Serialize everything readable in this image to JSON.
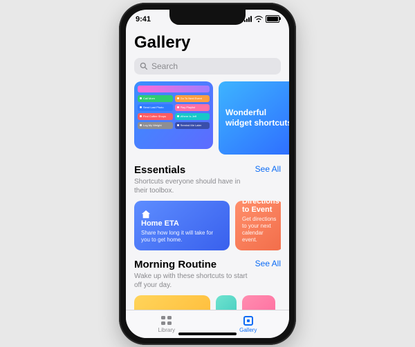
{
  "status": {
    "time": "9:41"
  },
  "page_title": "Gallery",
  "search": {
    "placeholder": "Search"
  },
  "hero": {
    "left_chips": [
      [
        {
          "label": "Call Mom",
          "color": "c-green"
        },
        {
          "label": "Go To Next Event",
          "color": "c-orange"
        }
      ],
      [
        {
          "label": "Send Last Photo",
          "color": "c-blue"
        },
        {
          "label": "Play Playlist",
          "color": "c-pink"
        }
      ],
      [
        {
          "label": "Find Coffee Shops",
          "color": "c-red"
        },
        {
          "label": "Where Is Jeff",
          "color": "c-teal"
        }
      ],
      [
        {
          "label": "Log My Weight",
          "color": "c-gray"
        },
        {
          "label": "Remind Me Later",
          "color": "c-navy"
        }
      ]
    ],
    "right_title": "Wonderful widget shortcuts"
  },
  "sections": [
    {
      "title": "Essentials",
      "see_all": "See All",
      "subtitle": "Shortcuts everyone should have in their toolbox.",
      "cards": [
        {
          "kind": "blue",
          "icon": "home",
          "title": "Home ETA",
          "sub": "Share how long it will take for you to get home."
        },
        {
          "kind": "orange",
          "icon": "star",
          "title": "Directions to Event",
          "sub": "Get directions to your next calendar event."
        }
      ]
    },
    {
      "title": "Morning Routine",
      "see_all": "See All",
      "subtitle": "Wake up with these shortcuts to start off your day.",
      "cards": [
        {
          "kind": "yellow"
        },
        {
          "kind": "mint"
        },
        {
          "kind": "pink"
        }
      ]
    }
  ],
  "tabs": {
    "library": "Library",
    "gallery": "Gallery"
  }
}
